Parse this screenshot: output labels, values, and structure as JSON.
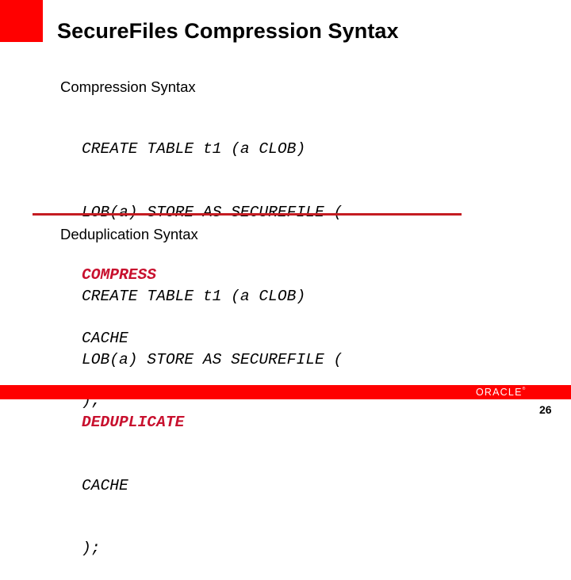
{
  "slide": {
    "title": "SecureFiles Compression Syntax",
    "accent_color": "#ff0000",
    "sections": [
      {
        "heading": "Compression Syntax",
        "code_lines": [
          {
            "text": "CREATE TABLE t1 (a CLOB)",
            "highlight": false
          },
          {
            "text": "LOB(a) STORE AS SECUREFILE (",
            "highlight": false
          },
          {
            "text": "COMPRESS",
            "highlight": true
          },
          {
            "text": "CACHE",
            "highlight": false
          },
          {
            "text": ");",
            "highlight": false
          }
        ]
      },
      {
        "heading": "Deduplication Syntax",
        "code_lines": [
          {
            "text": "CREATE TABLE t1 (a CLOB)",
            "highlight": false
          },
          {
            "text": "LOB(a) STORE AS SECUREFILE (",
            "highlight": false
          },
          {
            "text": "DEDUPLICATE",
            "highlight": true
          },
          {
            "text": "CACHE",
            "highlight": false
          },
          {
            "text": ");",
            "highlight": false
          }
        ]
      }
    ],
    "highlight_color": "#c8102e"
  },
  "footer": {
    "logo_text": "ORACLE",
    "logo_mark": "®",
    "page_number": "26"
  }
}
